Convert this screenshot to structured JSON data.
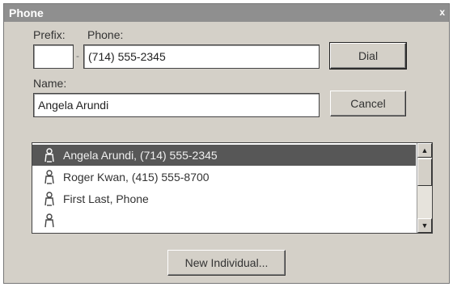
{
  "window": {
    "title": "Phone",
    "close_glyph": "x"
  },
  "prefix": {
    "label": "Prefix:",
    "value": ""
  },
  "separator": "-",
  "phone": {
    "label": "Phone:",
    "value": "(714) 555-2345"
  },
  "name": {
    "label": "Name:",
    "value": "Angela Arundi"
  },
  "buttons": {
    "dial": "Dial",
    "cancel": "Cancel",
    "new_individual": "New Individual..."
  },
  "list": {
    "items": [
      {
        "text": "Angela Arundi, (714) 555-2345",
        "selected": true
      },
      {
        "text": "Roger Kwan, (415) 555-8700",
        "selected": false
      },
      {
        "text": "First Last, Phone",
        "selected": false
      },
      {
        "text": "",
        "selected": false
      }
    ],
    "icon": "person-icon"
  },
  "colors": {
    "selection": "#575757",
    "titlebar": "#8f8f8f",
    "face": "#d4d0c8"
  }
}
